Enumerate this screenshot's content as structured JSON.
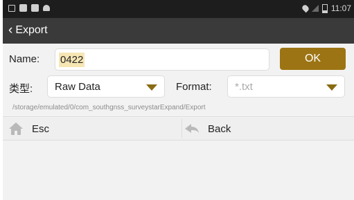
{
  "status_bar": {
    "time": "11:07",
    "left_icons": [
      "image-icon",
      "square-icon",
      "lock-icon",
      "android-icon"
    ],
    "right_icons": [
      "location-icon",
      "no-signal-icon",
      "battery-icon"
    ]
  },
  "header": {
    "back_icon": "chevron-left-icon",
    "title": "Export"
  },
  "form": {
    "name_label": "Name:",
    "name_value": "0422",
    "ok_label": "OK",
    "type_label": "类型:",
    "type_value": "Raw Data",
    "format_label": "Format:",
    "format_placeholder": "*.txt",
    "accent_color": "#9c7414"
  },
  "path": "/storage/emulated/0/com_southgnss_surveystarExpand/Export",
  "actions": {
    "esc_label": "Esc",
    "esc_icon": "home-icon",
    "back_label": "Back",
    "back_icon": "back-arrow-icon"
  }
}
